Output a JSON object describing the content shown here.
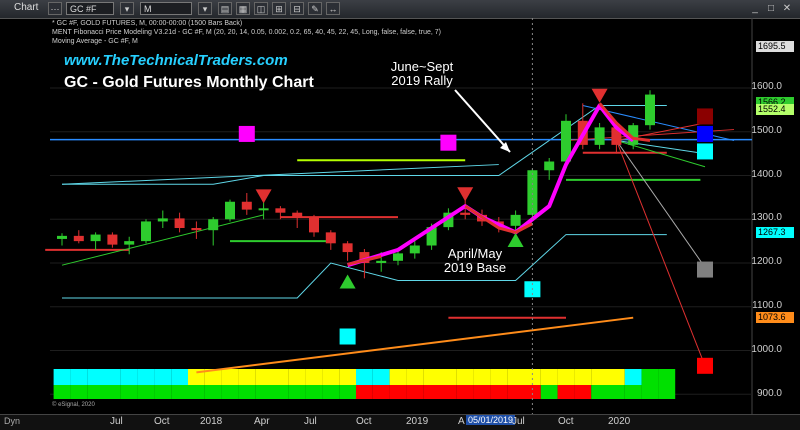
{
  "window": {
    "tab": "Chart",
    "symbol": "GC #F",
    "interval": "M"
  },
  "studies": [
    "* GC #F, GOLD FUTURES, M, 00:00-00:00 (1500 Bars Back)",
    "MENT Fibonacci Price Modeling V3.21d - GC #F, M (20, 20, 14, 0.05, 0.002, 0.2, 65, 40, 45, 22, 45, Long, false, false, true, 7)",
    "Moving Average - GC #F, M"
  ],
  "website": "www.TheTechnicalTraders.com",
  "title": "GC - Gold Futures Monthly Chart",
  "annotations": {
    "rally_line1": "June~Sept",
    "rally_line2": "2019 Rally",
    "base_line1": "April/May",
    "base_line2": "2019 Base"
  },
  "y_axis": [
    "1600.0",
    "1500.0",
    "1400.0",
    "1300.0",
    "1200.0",
    "1100.0",
    "1000.0",
    "900.0"
  ],
  "price_tags": {
    "top": "1695.5",
    "high1": "1566.2",
    "high2": "1552.4",
    "mid": "1267.3",
    "low": "1073.6"
  },
  "x_axis": {
    "labels": [
      "Jul",
      "Oct",
      "2018",
      "Apr",
      "Jul",
      "Oct",
      "2019",
      "Jul",
      "Oct",
      "2020"
    ],
    "highlight_prefix": "A",
    "highlight": "05/01/2019"
  },
  "footer": {
    "esignal": "© eSignal, 2020",
    "dyn": "Dyn"
  },
  "colors": {
    "up_candle": "#2ecc2e",
    "down_candle": "#e03030",
    "magenta": "#ff00ff",
    "cyan": "#00ffff",
    "band": "#5fd7e8",
    "hline": "#2a8cff"
  },
  "chart_data": {
    "type": "candlestick",
    "interval": "monthly",
    "ylim": [
      880,
      1720
    ],
    "candles": [
      {
        "o": 1255,
        "h": 1268,
        "l": 1240,
        "c": 1262
      },
      {
        "o": 1262,
        "h": 1275,
        "l": 1245,
        "c": 1250
      },
      {
        "o": 1250,
        "h": 1270,
        "l": 1230,
        "c": 1265
      },
      {
        "o": 1265,
        "h": 1270,
        "l": 1235,
        "c": 1242
      },
      {
        "o": 1242,
        "h": 1260,
        "l": 1220,
        "c": 1250
      },
      {
        "o": 1250,
        "h": 1300,
        "l": 1245,
        "c": 1295
      },
      {
        "o": 1295,
        "h": 1320,
        "l": 1280,
        "c": 1302
      },
      {
        "o": 1302,
        "h": 1315,
        "l": 1270,
        "c": 1280
      },
      {
        "o": 1280,
        "h": 1295,
        "l": 1255,
        "c": 1275
      },
      {
        "o": 1275,
        "h": 1305,
        "l": 1240,
        "c": 1300
      },
      {
        "o": 1300,
        "h": 1345,
        "l": 1295,
        "c": 1340
      },
      {
        "o": 1340,
        "h": 1360,
        "l": 1310,
        "c": 1322
      },
      {
        "o": 1322,
        "h": 1345,
        "l": 1300,
        "c": 1325
      },
      {
        "o": 1325,
        "h": 1330,
        "l": 1300,
        "c": 1315
      },
      {
        "o": 1315,
        "h": 1320,
        "l": 1280,
        "c": 1305
      },
      {
        "o": 1305,
        "h": 1310,
        "l": 1260,
        "c": 1270
      },
      {
        "o": 1270,
        "h": 1275,
        "l": 1230,
        "c": 1245
      },
      {
        "o": 1245,
        "h": 1250,
        "l": 1205,
        "c": 1225
      },
      {
        "o": 1225,
        "h": 1232,
        "l": 1165,
        "c": 1200
      },
      {
        "o": 1200,
        "h": 1225,
        "l": 1180,
        "c": 1205
      },
      {
        "o": 1205,
        "h": 1230,
        "l": 1195,
        "c": 1222
      },
      {
        "o": 1222,
        "h": 1250,
        "l": 1210,
        "c": 1240
      },
      {
        "o": 1240,
        "h": 1290,
        "l": 1230,
        "c": 1282
      },
      {
        "o": 1282,
        "h": 1325,
        "l": 1275,
        "c": 1315
      },
      {
        "o": 1315,
        "h": 1345,
        "l": 1300,
        "c": 1310
      },
      {
        "o": 1310,
        "h": 1322,
        "l": 1285,
        "c": 1295
      },
      {
        "o": 1295,
        "h": 1305,
        "l": 1270,
        "c": 1285
      },
      {
        "o": 1285,
        "h": 1320,
        "l": 1275,
        "c": 1310
      },
      {
        "o": 1310,
        "h": 1415,
        "l": 1300,
        "c": 1412
      },
      {
        "o": 1412,
        "h": 1440,
        "l": 1390,
        "c": 1432
      },
      {
        "o": 1432,
        "h": 1540,
        "l": 1420,
        "c": 1525
      },
      {
        "o": 1525,
        "h": 1565,
        "l": 1460,
        "c": 1470
      },
      {
        "o": 1470,
        "h": 1520,
        "l": 1460,
        "c": 1510
      },
      {
        "o": 1510,
        "h": 1515,
        "l": 1450,
        "c": 1470
      },
      {
        "o": 1470,
        "h": 1520,
        "l": 1460,
        "c": 1515
      },
      {
        "o": 1515,
        "h": 1595,
        "l": 1505,
        "c": 1585
      }
    ],
    "candle_first_month": "2017-05",
    "x_label_months": [
      "2017-07",
      "2017-10",
      "2018-01",
      "2018-04",
      "2018-07",
      "2018-10",
      "2019-01",
      "2019-07",
      "2019-10",
      "2020-01"
    ],
    "fib_bands": {
      "upper_cyan": [
        [
          0,
          1380
        ],
        [
          9,
          1380
        ],
        [
          12,
          1400
        ],
        [
          16,
          1400
        ],
        [
          26,
          1400
        ],
        [
          32,
          1560
        ],
        [
          36,
          1560
        ]
      ],
      "lower_cyan": [
        [
          0,
          1120
        ],
        [
          14,
          1120
        ],
        [
          16,
          1200
        ],
        [
          20,
          1160
        ],
        [
          27,
          1160
        ],
        [
          30,
          1265
        ],
        [
          36,
          1265
        ]
      ]
    },
    "levels": [
      {
        "price": 1482,
        "color": "#2a8cff",
        "name": "horizontal blue"
      },
      {
        "price": 1250,
        "color": "#2ecc2e",
        "x": [
          10,
          16
        ]
      },
      {
        "price": 1230,
        "color": "#e03030",
        "x": [
          -1,
          4
        ]
      },
      {
        "price": 1305,
        "color": "#e03030",
        "x": [
          13,
          20
        ]
      },
      {
        "price": 1435,
        "color": "#b4ff00",
        "x": [
          14,
          24
        ]
      },
      {
        "price": 1390,
        "color": "#2ecc2e",
        "x": [
          30,
          38
        ]
      },
      {
        "price": 1452,
        "color": "#e03030",
        "x": [
          31,
          36
        ]
      },
      {
        "price": 1075,
        "color": "#e03030",
        "x": [
          23,
          30
        ]
      }
    ],
    "markers": [
      {
        "type": "square",
        "color": "#ff00ff",
        "t": 11,
        "price": 1495
      },
      {
        "type": "square",
        "color": "#ff00ff",
        "t": 23,
        "price": 1475
      },
      {
        "type": "square",
        "color": "#00ffff",
        "t": 17,
        "price": 1032
      },
      {
        "type": "square",
        "color": "#00ffff",
        "t": 28,
        "price": 1140
      },
      {
        "type": "tri-down",
        "color": "#e03030",
        "t": 12,
        "price": 1350
      },
      {
        "type": "tri-down",
        "color": "#e03030",
        "t": 24,
        "price": 1355
      },
      {
        "type": "tri-down",
        "color": "#e03030",
        "t": 32,
        "price": 1580
      },
      {
        "type": "tri-up",
        "color": "#2ecc2e",
        "t": 17,
        "price": 1160
      },
      {
        "type": "tri-up",
        "color": "#2ecc2e",
        "t": 27,
        "price": 1255
      }
    ],
    "projection_squares": [
      {
        "color": "#8b0000",
        "price": 1535
      },
      {
        "color": "#0000ff",
        "price": 1495
      },
      {
        "color": "#00ffff",
        "price": 1455
      },
      {
        "color": "#808080",
        "price": 1185
      },
      {
        "color": "#ff0000",
        "price": 965
      }
    ],
    "magenta_arc": [
      [
        17,
        1195
      ],
      [
        20,
        1230
      ],
      [
        22,
        1280
      ],
      [
        24,
        1330
      ],
      [
        25,
        1305
      ],
      [
        27,
        1270
      ],
      [
        29,
        1330
      ],
      [
        30,
        1425
      ],
      [
        32,
        1560
      ],
      [
        33,
        1510
      ],
      [
        34,
        1480
      ]
    ],
    "orange_trend": [
      [
        8,
        950
      ],
      [
        34,
        1075
      ]
    ],
    "trend_lines": [
      {
        "color": "#2ecc2e",
        "from": [
          0,
          1195
        ],
        "to": [
          12,
          1310
        ]
      },
      {
        "color": "#5fd7e8",
        "from": [
          0,
          1380
        ],
        "to": [
          26,
          1425
        ]
      },
      {
        "color": "#2a8cff",
        "from": [
          31,
          1560
        ],
        "to": [
          40,
          1480
        ]
      },
      {
        "color": "#e03030",
        "from": [
          30,
          1480
        ],
        "to": [
          40,
          1505
        ]
      }
    ],
    "regime_bar": {
      "top": [
        "cyan",
        "cyan",
        "cyan",
        "cyan",
        "cyan",
        "cyan",
        "cyan",
        "cyan",
        "yellow",
        "yellow",
        "yellow",
        "yellow",
        "yellow",
        "yellow",
        "yellow",
        "yellow",
        "yellow",
        "yellow",
        "cyan",
        "cyan",
        "yellow",
        "yellow",
        "yellow",
        "yellow",
        "yellow",
        "yellow",
        "yellow",
        "yellow",
        "yellow",
        "yellow",
        "yellow",
        "yellow",
        "yellow",
        "yellow",
        "cyan",
        "#00e000",
        "#00e000"
      ],
      "bottom": [
        "#00e000",
        "#00e000",
        "#00e000",
        "#00e000",
        "#00e000",
        "#00e000",
        "#00e000",
        "#00e000",
        "#00e000",
        "#00e000",
        "#00e000",
        "#00e000",
        "#00e000",
        "#00e000",
        "#00e000",
        "#00e000",
        "#00e000",
        "#00e000",
        "red",
        "red",
        "red",
        "red",
        "red",
        "red",
        "red",
        "red",
        "red",
        "red",
        "red",
        "#00e000",
        "red",
        "red",
        "#00e000",
        "#00e000",
        "#00e000",
        "#00e000",
        "#00e000"
      ]
    }
  }
}
